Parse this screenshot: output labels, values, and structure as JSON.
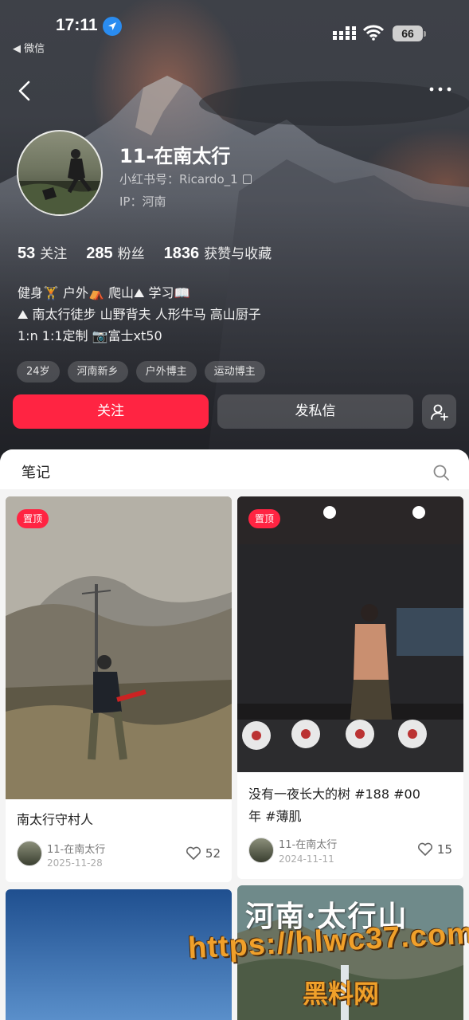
{
  "status_bar": {
    "time": "17:11",
    "back_app": "◀ 微信",
    "battery": "66"
  },
  "profile": {
    "nickname": "11-在南太行",
    "red_id": "小红书号：Ricardo_1",
    "ip": "IP：河南",
    "stats": [
      {
        "num": "53",
        "label": "关注"
      },
      {
        "num": "285",
        "label": "粉丝"
      },
      {
        "num": "1836",
        "label": "获赞与收藏"
      }
    ],
    "bio": [
      "健身🏋 户外⛺ 爬山⛰ 学习📖",
      "⛰ 南太行徒步 山野背夫 人形牛马 高山厨子",
      "1:n 1:1定制 📷富士xt50"
    ],
    "tags": [
      "24岁",
      "河南新乡",
      "户外博主",
      "运动博主"
    ],
    "follow_label": "关注",
    "message_label": "发私信"
  },
  "notes": {
    "section_title": "笔记",
    "cards": [
      {
        "pin": "置顶",
        "title": "南太行守村人",
        "author": "11-在南太行",
        "date": "2025-11-28",
        "likes": "52"
      },
      {
        "pin": "置顶",
        "title_line1": "没有一夜长大的树 #188 #00",
        "title_line2": "年 #薄肌",
        "author": "11-在南太行",
        "date": "2024-11-11",
        "likes": "15"
      },
      {
        "overlay_text": "河南·太行山"
      }
    ]
  },
  "watermark": {
    "url": "https://hlwc37.com",
    "name": "黑料网"
  },
  "colors": {
    "accent": "#ff2442",
    "hero_dark": "#25272c"
  }
}
